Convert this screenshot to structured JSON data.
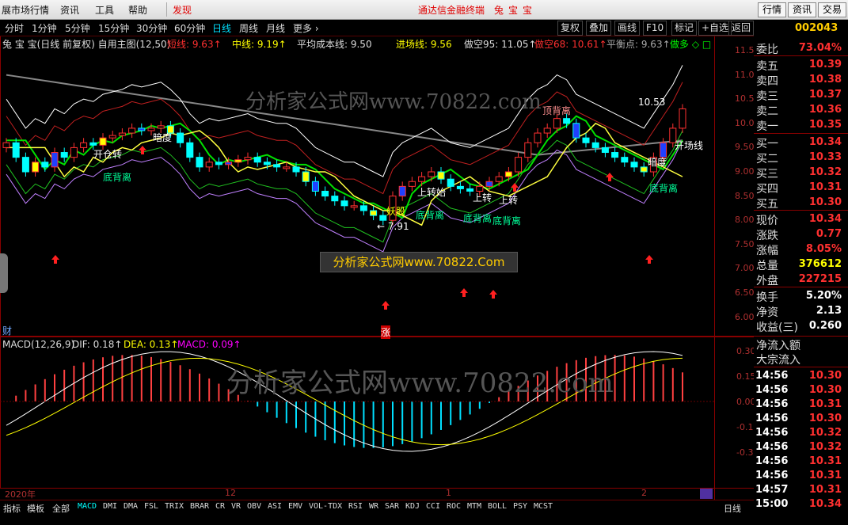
{
  "menubar": {
    "items": [
      "展市场行情",
      "资讯",
      "工具",
      "帮助",
      "发现"
    ],
    "title": "通达信金融终端",
    "title2": "兔宝宝",
    "right_buttons": [
      "行情",
      "资讯",
      "交易"
    ]
  },
  "toolbar": {
    "periods": [
      "分时",
      "1分钟",
      "5分钟",
      "15分钟",
      "30分钟",
      "60分钟",
      "日线",
      "周线",
      "月线",
      "更多 ›"
    ],
    "active_period": "日线",
    "actions": [
      "复权",
      "叠加",
      "画线",
      "F10",
      "标记",
      "+自选",
      "返回"
    ]
  },
  "stock_code": "002043",
  "infoline": {
    "name": "兔 宝 宝(日线 前复权) 自用主图(12,50)",
    "short_line": "短线: 9.63↑",
    "mid_line": "中线: 9.19↑",
    "avg_cost": "平均成本线: 9.50",
    "entry_line": "进场线: 9.56",
    "short_95": "做空95: 11.05↑",
    "short_68": "做空68: 10.61↑",
    "balance": "平衡点: 9.63↑",
    "long_label": "做多 ◇ □"
  },
  "price_axis": [
    "11.50",
    "11.00",
    "10.50",
    "10.00",
    "9.50",
    "9.00",
    "8.50",
    "8.00",
    "7.50",
    "7.00",
    "6.50",
    "6.00"
  ],
  "macd_axis": [
    "0.30",
    "0.15",
    "0.00",
    "-0.15",
    "-0.30"
  ],
  "macd_header": {
    "name": "MACD(12,26,9)",
    "dif": "DIF: 0.18↑",
    "dea": "DEA: 0.13↑",
    "macd": "MACD: 0.09↑"
  },
  "chart_labels": {
    "high_marker": "10.53",
    "low_marker": "← 7.91",
    "kaicang": "开仓转",
    "andu": "暗度",
    "dibeili1": "底背离",
    "dibeili2": "底背离",
    "dibeili3": "底背离",
    "dibeili4": "底背离",
    "dibeili5": "底背离",
    "dingbeili": "顶背离",
    "yaogu": "妖股",
    "shangzhuan1": "上转",
    "shangzhuan2": "上转",
    "kaishi": "上转始",
    "kaicang2": "开场线",
    "andu2": "暗度",
    "cai": "财",
    "zhang": "涨",
    "x_2020": "2020年",
    "x_12": "12",
    "x_1": "1",
    "x_2": "2"
  },
  "watermarks": {
    "top": "分析家公式网www.70822.com",
    "box": "分析家公式网www.70822.Com",
    "bottom": "分析家公式网www.70822.com"
  },
  "quote_panel": [
    {
      "k": "委比",
      "v": "73.04%",
      "c": "#ff3030"
    },
    {
      "k": "卖五",
      "v": "10.39",
      "c": "#ff3030"
    },
    {
      "k": "卖四",
      "v": "10.38",
      "c": "#ff3030"
    },
    {
      "k": "卖三",
      "v": "10.37",
      "c": "#ff3030"
    },
    {
      "k": "卖二",
      "v": "10.36",
      "c": "#ff3030"
    },
    {
      "k": "卖一",
      "v": "10.35",
      "c": "#ff3030"
    },
    {
      "k": "买一",
      "v": "10.34",
      "c": "#ff3030"
    },
    {
      "k": "买二",
      "v": "10.33",
      "c": "#ff3030"
    },
    {
      "k": "买三",
      "v": "10.32",
      "c": "#ff3030"
    },
    {
      "k": "买四",
      "v": "10.31",
      "c": "#ff3030"
    },
    {
      "k": "买五",
      "v": "10.30",
      "c": "#ff3030"
    },
    {
      "k": "现价",
      "v": "10.34",
      "c": "#ff3030"
    },
    {
      "k": "涨跌",
      "v": "0.77",
      "c": "#ff3030"
    },
    {
      "k": "涨幅",
      "v": "8.05%",
      "c": "#ff3030"
    },
    {
      "k": "总量",
      "v": "376612",
      "c": "#ffff00"
    },
    {
      "k": "外盘",
      "v": "227215",
      "c": "#ff3030"
    },
    {
      "k": "换手",
      "v": "5.20%",
      "c": "#ffffff"
    },
    {
      "k": "净资",
      "v": "2.13",
      "c": "#ffffff"
    },
    {
      "k": "收益(三)",
      "v": "0.260",
      "c": "#ffffff"
    }
  ],
  "flow_labels": [
    "净流入额",
    "大宗流入"
  ],
  "tape": [
    {
      "t": "14:56",
      "p": "10.30"
    },
    {
      "t": "14:56",
      "p": "10.30"
    },
    {
      "t": "14:56",
      "p": "10.31"
    },
    {
      "t": "14:56",
      "p": "10.30"
    },
    {
      "t": "14:56",
      "p": "10.32"
    },
    {
      "t": "14:56",
      "p": "10.32"
    },
    {
      "t": "14:56",
      "p": "10.31"
    },
    {
      "t": "14:56",
      "p": "10.31"
    },
    {
      "t": "14:57",
      "p": "10.31"
    },
    {
      "t": "15:00",
      "p": "10.34"
    }
  ],
  "bottom_tabs": [
    "指标",
    "模板",
    "全部",
    "MACD",
    "DMI",
    "DMA",
    "FSL",
    "TRIX",
    "BRAR",
    "CR",
    "VR",
    "OBV",
    "ASI",
    "EMV",
    "VOL-TDX",
    "RSI",
    "WR",
    "SAR",
    "KDJ",
    "CCI",
    "ROC",
    "MTM",
    "BOLL",
    "PSY",
    "MCST"
  ],
  "bottom_right": "日线",
  "colors": {
    "up": "#ff3030",
    "down": "#00ffff",
    "axis": "#b03030",
    "accent": "#ffcc00"
  }
}
